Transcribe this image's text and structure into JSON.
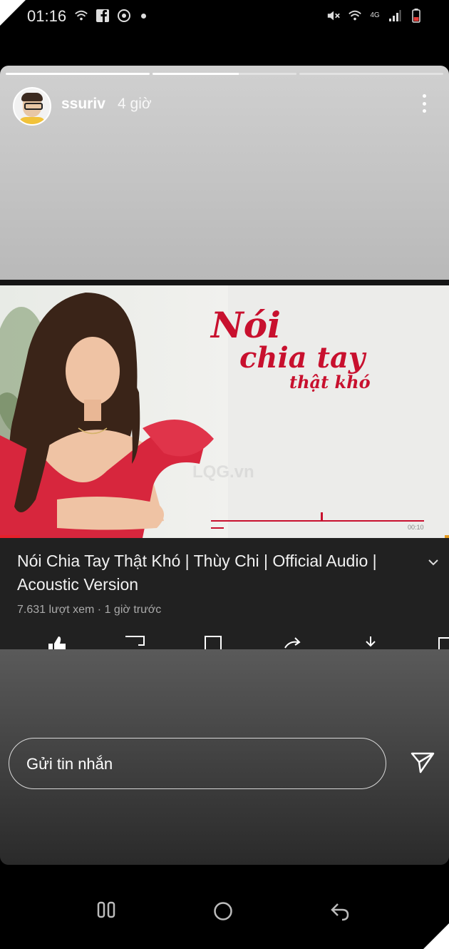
{
  "status_bar": {
    "time": "01:16",
    "left_icons": [
      "wifi-call-icon",
      "facebook-icon",
      "messenger-icon",
      "notification-dot-icon"
    ],
    "network": "4G",
    "right_icons": [
      "mute-icon",
      "wifi-icon",
      "signal-icon",
      "battery-icon"
    ]
  },
  "story": {
    "username": "ssuriv",
    "time_ago": "4 giờ",
    "progress": [
      1.0,
      0.6,
      0.0
    ]
  },
  "video": {
    "cover_title_line1": "Nói",
    "cover_title_line2": "chia tay",
    "cover_title_line3": "thật khó",
    "watermark": "LQG.vn",
    "player_time": "00:10",
    "title": "Nói Chia Tay Thật Khó | Thùy Chi | Official Audio | Acoustic Version",
    "meta": "7.631 lượt xem · 1 giờ trước"
  },
  "message": {
    "placeholder": "Gửi tin nhắn"
  },
  "colors": {
    "accent_red": "#e5202a",
    "cover_text": "#c8102e",
    "dress": "#d7263d"
  }
}
